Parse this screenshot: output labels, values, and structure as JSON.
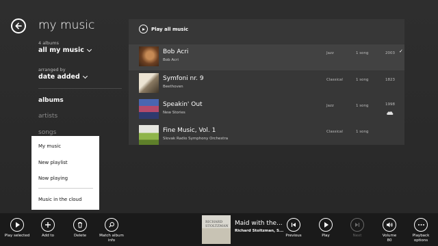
{
  "header": {
    "title": "my music",
    "album_count": "4 albums",
    "filter": "all my music",
    "arranged_label": "arranged by",
    "sort": "date added"
  },
  "nav": {
    "albums": "albums",
    "artists": "artists",
    "songs": "songs"
  },
  "popup_menu": {
    "items": [
      "My music",
      "New playlist",
      "Now playing",
      "Music in the cloud"
    ]
  },
  "panel": {
    "play_all": "Play all music",
    "albums": [
      {
        "title": "Bob Acri",
        "artist": "Bob Acri",
        "genre": "Jazz",
        "songs": "1 song",
        "year": "2003",
        "selected": true
      },
      {
        "title": "Symfoni nr. 9",
        "artist": "Beethoven",
        "genre": "Classical",
        "songs": "1 song",
        "year": "1823"
      },
      {
        "title": "Speakin' Out",
        "artist": "New Stories",
        "genre": "Jazz",
        "songs": "1 song",
        "year": "1998",
        "cloud": true
      },
      {
        "title": "Fine Music, Vol. 1",
        "artist": "Slovak Radio Symphony Orchestra",
        "genre": "Classical",
        "songs": "1 song",
        "year": ""
      }
    ]
  },
  "appbar": {
    "play_selected": "Play selected",
    "add_to": "Add to",
    "delete": "Delete",
    "match_album": "Match album\ninfo",
    "previous": "Previous",
    "play": "Play",
    "next": "Next",
    "volume": "Volume\n80",
    "playback_options": "Playback\noptions"
  },
  "now_playing": {
    "title": "Maid with the...",
    "artist": "Richard Stoltzman, S...",
    "art_text": "RICHARD\nSTOLTZMAN"
  }
}
